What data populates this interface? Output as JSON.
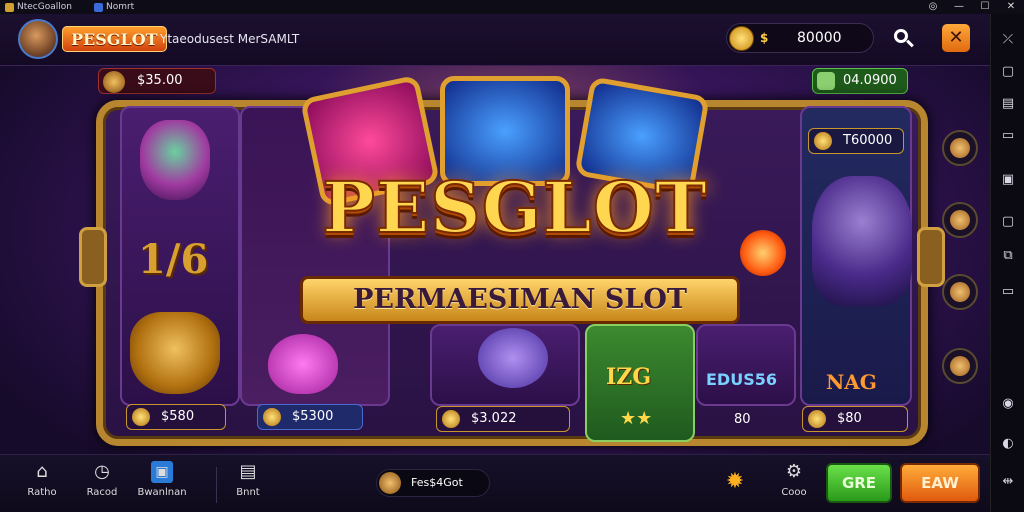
{
  "window": {
    "tab1_title": "NtecGoallon",
    "tab2_title": "Nomrt",
    "controls": [
      "◎",
      "—",
      "☐",
      "✕"
    ]
  },
  "topbar": {
    "logo_text": "PESGLOT",
    "subtitle": "Ytaeodusest MerSAMLT",
    "currency_symbol": "$",
    "balance": "80000"
  },
  "stage": {
    "left_pill": "$35.00",
    "right_pill": "04.0900",
    "title": "PESGLOT",
    "subtitle": "PERMAESIMAN SLOT",
    "reel1_number": "1/6",
    "chip1": "$580",
    "chip2": "$5300",
    "chip3": "$3.022",
    "chip_top_right": "T60000",
    "reel4_text": "IZG",
    "reel4_stars": "★★",
    "reel5_text": "EDUS56",
    "reel5_value": "80",
    "reel6_text": "NAG",
    "chip6": "$80"
  },
  "bottombar": {
    "nav": [
      {
        "label": "Ratho",
        "icon": "home-icon"
      },
      {
        "label": "Racod",
        "icon": "clock-icon"
      },
      {
        "label": "Bwanlnan",
        "icon": "store-icon"
      },
      {
        "label": "Bnnt",
        "icon": "tray-icon"
      }
    ],
    "balance_label": "Fes$4Got",
    "settings_label": "Cooo",
    "green_button": "GRE",
    "orange_button": "EAW"
  },
  "colors": {
    "accent_gold": "#ffd650",
    "green": "#2a9a1a",
    "orange": "#e05a0e",
    "purple_bg": "#3a1660"
  }
}
